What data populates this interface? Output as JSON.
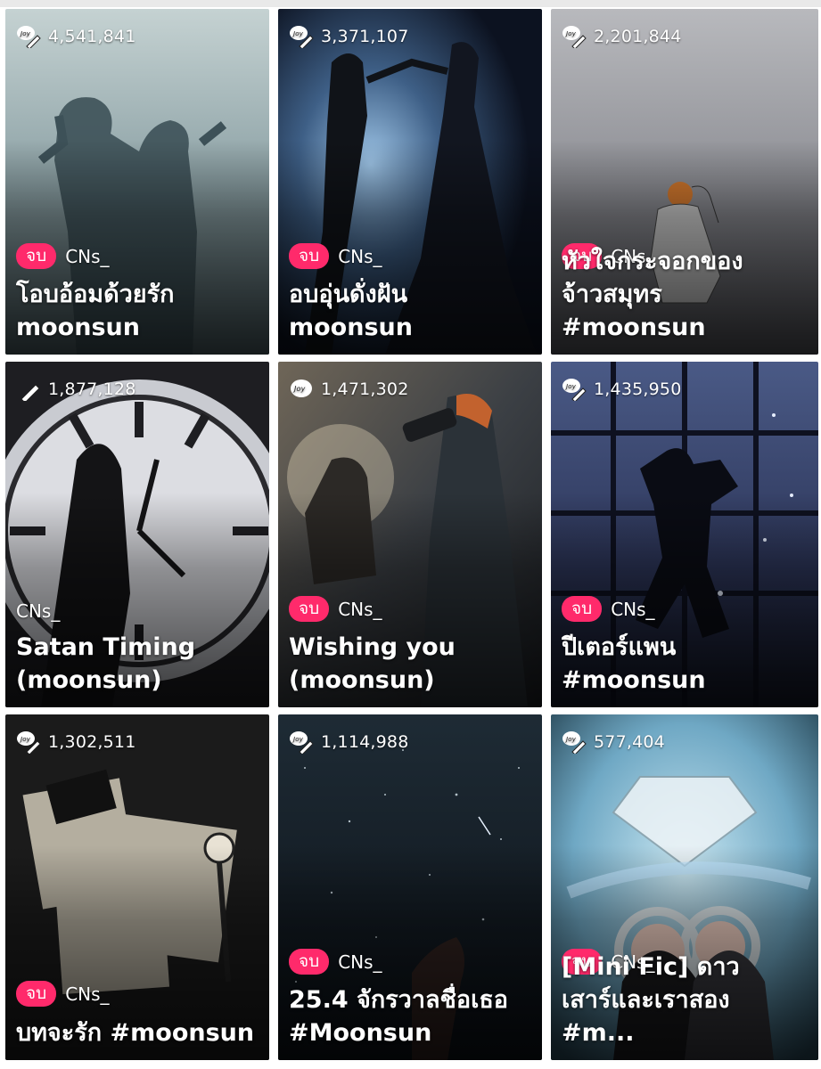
{
  "cards": [
    {
      "views": "4,541,841",
      "badge": "จบ",
      "author": "CNs_",
      "title": "โอบอ้อมด้วยรัก\nmoonsun",
      "icons": [
        "joy-icon",
        "pen-icon"
      ]
    },
    {
      "views": "3,371,107",
      "badge": "จบ",
      "author": "CNs_",
      "title": "อบอุ่นดั่งฝัน\nmoonsun",
      "icons": [
        "joy-icon",
        "pen-icon"
      ]
    },
    {
      "views": "2,201,844",
      "badge": "จบ",
      "author": "CNs_",
      "title": "หัวใจกระจอกของ\nจ้าวสมุทร #moonsun",
      "icons": [
        "joy-icon",
        "pen-icon"
      ]
    },
    {
      "views": "1,877,128",
      "badge": "",
      "author": "CNs_",
      "title": "Satan Timing\n(moonsun)",
      "icons": [
        "pen-icon"
      ]
    },
    {
      "views": "1,471,302",
      "badge": "จบ",
      "author": "CNs_",
      "title": "Wishing you\n(moonsun)",
      "icons": [
        "joy-icon"
      ]
    },
    {
      "views": "1,435,950",
      "badge": "จบ",
      "author": "CNs_",
      "title": "ปีเตอร์แพน\n#moonsun",
      "icons": [
        "joy-icon",
        "pen-icon"
      ]
    },
    {
      "views": "1,302,511",
      "badge": "จบ",
      "author": "CNs_",
      "title": "บทจะรัก #moonsun",
      "icons": [
        "joy-icon",
        "pen-icon"
      ]
    },
    {
      "views": "1,114,988",
      "badge": "จบ",
      "author": "CNs_",
      "title": "25.4 จักรวาลชื่อเธอ\n#Moonsun",
      "icons": [
        "joy-icon",
        "pen-icon"
      ]
    },
    {
      "views": "577,404",
      "badge": "จบ",
      "author": "CNs_",
      "title": "[Mini Fic] ดาว\nเสาร์และเราสอง #m...",
      "icons": [
        "joy-icon",
        "pen-icon"
      ]
    }
  ],
  "colors": {
    "badge": "#ff2a6b",
    "text": "#ffffff",
    "background": "#ffffff"
  }
}
